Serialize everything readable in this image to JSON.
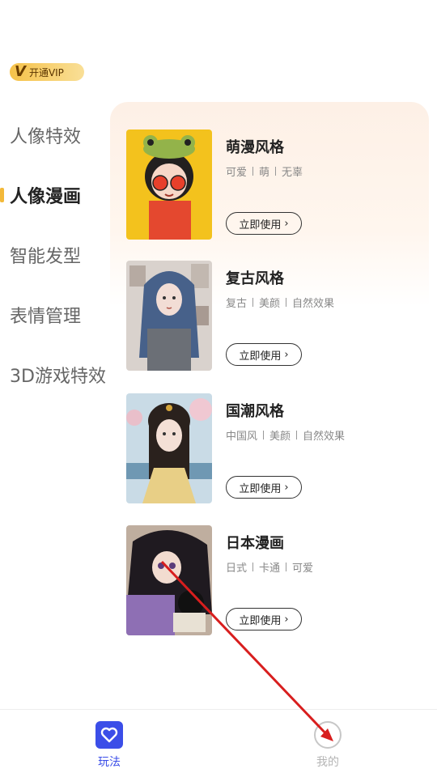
{
  "vip": {
    "mark": "V",
    "label": "开通VIP"
  },
  "sidebar": {
    "items": [
      {
        "label": "人像特效"
      },
      {
        "label": "人像漫画"
      },
      {
        "label": "智能发型"
      },
      {
        "label": "表情管理"
      },
      {
        "label": "3D游戏特效"
      }
    ],
    "active_index": 1
  },
  "cards": [
    {
      "title": "萌漫风格",
      "tags": [
        "可爱",
        "萌",
        "无辜"
      ],
      "button": "立即使用"
    },
    {
      "title": "复古风格",
      "tags": [
        "复古",
        "美颜",
        "自然效果"
      ],
      "button": "立即使用"
    },
    {
      "title": "国潮风格",
      "tags": [
        "中国风",
        "美颜",
        "自然效果"
      ],
      "button": "立即使用"
    },
    {
      "title": "日本漫画",
      "tags": [
        "日式",
        "卡通",
        "可爱"
      ],
      "button": "立即使用"
    }
  ],
  "bottom_nav": [
    {
      "label": "玩法",
      "icon": "heart-icon",
      "active": true
    },
    {
      "label": "我的",
      "icon": "profile-icon",
      "active": false
    }
  ],
  "colors": {
    "accent": "#3b4ee8",
    "vip_gold": "#f6c24a",
    "active_marker": "#f3b93a",
    "annotation_arrow": "#d81e1e"
  }
}
